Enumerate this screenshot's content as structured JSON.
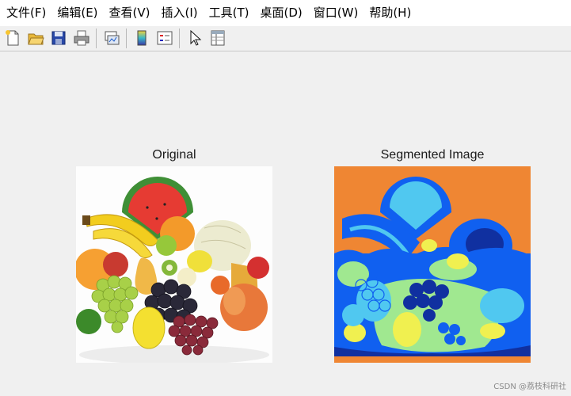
{
  "menubar": {
    "items": [
      {
        "label": "文件(F)"
      },
      {
        "label": "编辑(E)"
      },
      {
        "label": "查看(V)"
      },
      {
        "label": "插入(I)"
      },
      {
        "label": "工具(T)"
      },
      {
        "label": "桌面(D)"
      },
      {
        "label": "窗口(W)"
      },
      {
        "label": "帮助(H)"
      }
    ]
  },
  "toolbar": {
    "icons": [
      "new-figure-icon",
      "open-file-icon",
      "save-icon",
      "print-icon",
      "link-plot-icon",
      "insert-colorbar-icon",
      "insert-legend-icon",
      "edit-plot-pointer-icon",
      "property-inspector-icon"
    ]
  },
  "figure": {
    "left_title": "Original",
    "right_title": "Segmented Image"
  },
  "colors": {
    "segment_orange": "#ef8633",
    "segment_blue": "#1060f0",
    "segment_cyan": "#50c8f0",
    "segment_yellow": "#f0f050",
    "segment_green": "#a0e890",
    "segment_navy": "#1030a0"
  },
  "watermark": "CSDN @荔枝科研社"
}
